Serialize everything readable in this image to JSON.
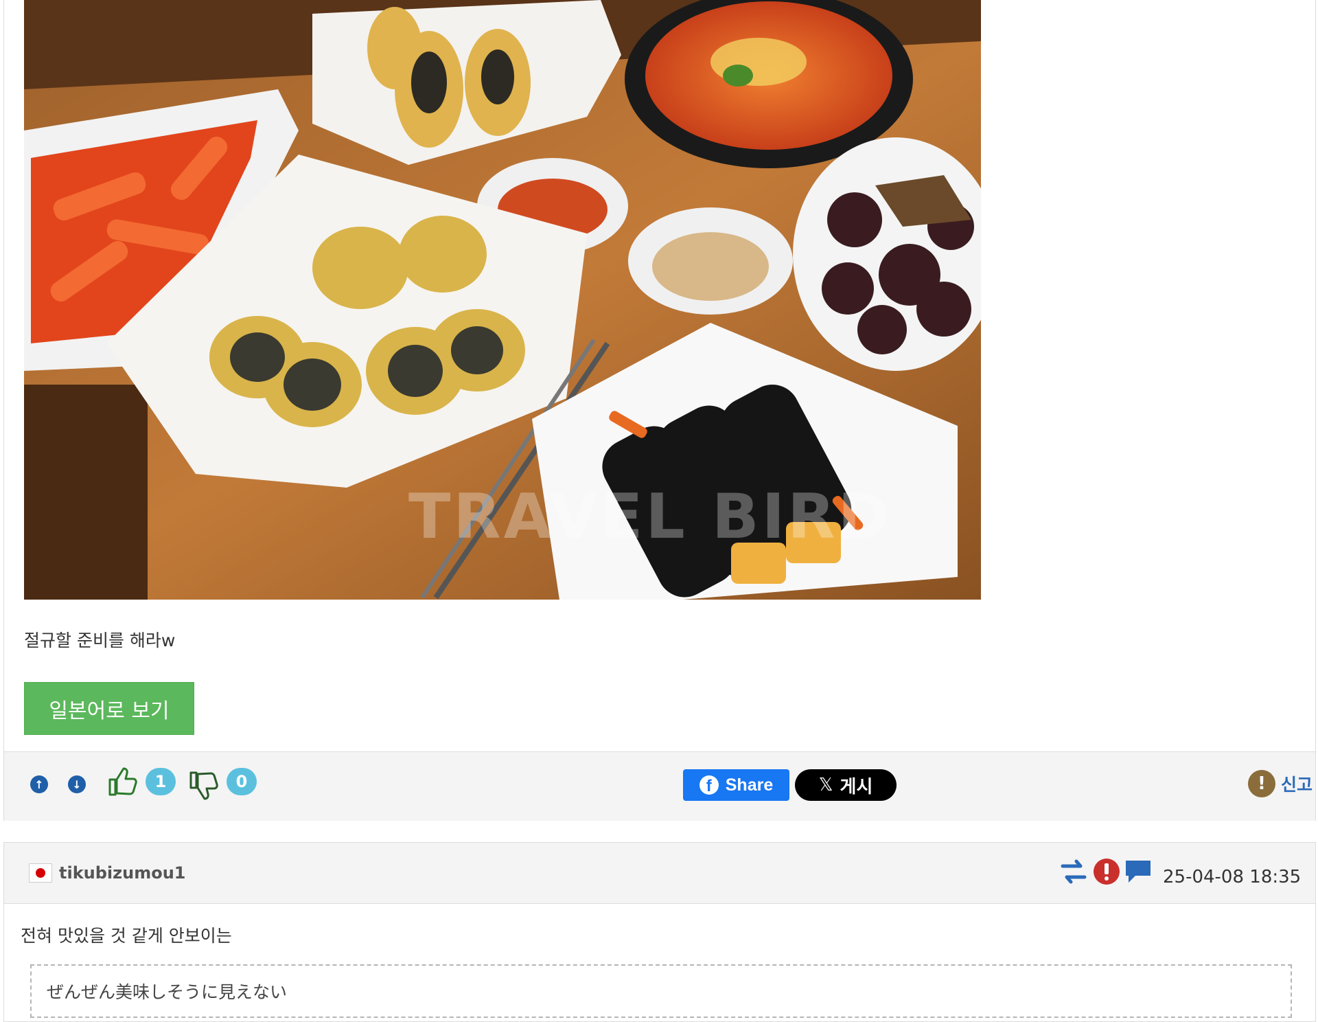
{
  "post": {
    "photo": {
      "watermark": "TRAVEL BIRD"
    },
    "body_text": "절규할 준비를 해라w",
    "translate_button": "일본어로 보기",
    "actions": {
      "up_label": "↑",
      "down_label": "↓",
      "like_count": "1",
      "dislike_count": "0",
      "fb_share": "Share",
      "x_post": "게시",
      "report": "신고"
    }
  },
  "comment": {
    "username": "tikubizumou1",
    "date": "25-04-08 18:35",
    "text": "전혀 맛있을 것 같게 안보이는",
    "translation": "ぜんぜん美味しそうに見えない"
  },
  "colors": {
    "green_button": "#5cb85c",
    "badge": "#5bc0de",
    "fb": "#1877f2",
    "report_link": "#2a6ab8"
  }
}
